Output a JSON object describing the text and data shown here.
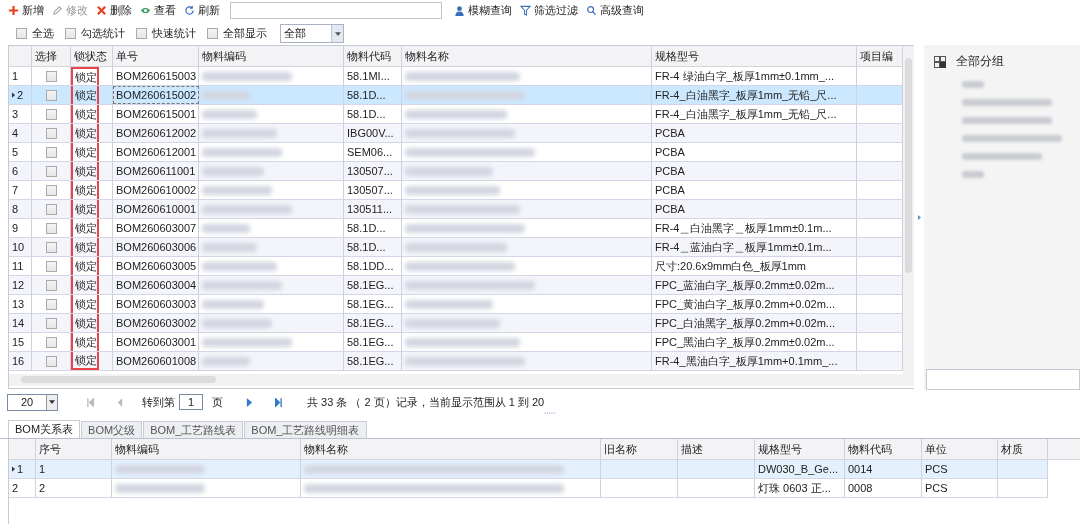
{
  "toolbar": {
    "buttons": [
      {
        "label": "新增",
        "kind": "add",
        "disabled": false
      },
      {
        "label": "修改",
        "kind": "edit",
        "disabled": true
      },
      {
        "label": "删除",
        "kind": "delete",
        "disabled": false
      },
      {
        "label": "查看",
        "kind": "view",
        "disabled": false
      },
      {
        "label": "刷新",
        "kind": "refresh",
        "disabled": false
      }
    ],
    "query_buttons": [
      {
        "label": "模糊查询",
        "kind": "person"
      },
      {
        "label": "筛选过滤",
        "kind": "filter"
      },
      {
        "label": "高级查询",
        "kind": "zoom"
      }
    ]
  },
  "filters": {
    "checkboxes": [
      {
        "label": "全选",
        "checked": false
      },
      {
        "label": "勾选统计",
        "checked": false
      },
      {
        "label": "快速统计",
        "checked": false
      },
      {
        "label": "全部显示",
        "checked": false
      }
    ],
    "dropdown": {
      "value": "全部"
    }
  },
  "grid": {
    "lock_frame": true,
    "columns": [
      {
        "label": "选择",
        "kind": "check"
      },
      {
        "label": "锁状态",
        "kind": "lock"
      },
      {
        "label": "单号",
        "kind": "text"
      },
      {
        "label": "物料编码",
        "kind": "blur"
      },
      {
        "label": "物料代码",
        "kind": "text"
      },
      {
        "label": "物料名称",
        "kind": "blur"
      },
      {
        "label": "规格型号",
        "kind": "text"
      },
      {
        "label": "项目编",
        "kind": "text"
      }
    ],
    "rows": [
      {
        "index": "1",
        "selected": false,
        "checked": false,
        "cells": [
          "",
          "锁定",
          "BOM260615003",
          "",
          "58.1MI...",
          "",
          "FR-4 绿油白字_板厚1mm±0.1mm_...",
          ""
        ]
      },
      {
        "index": "2",
        "selected": true,
        "checked": false,
        "cells": [
          "",
          "锁定",
          "BOM260615002",
          "",
          "58.1D...",
          "",
          "FR-4_白油黑字_板厚1mm_无铅_尺...",
          ""
        ]
      },
      {
        "index": "3",
        "selected": false,
        "checked": false,
        "cells": [
          "",
          "锁定",
          "BOM260615001",
          "",
          "58.1D...",
          "",
          "FR-4_白油黑字_板厚1mm_无铅_尺...",
          ""
        ]
      },
      {
        "index": "4",
        "selected": false,
        "checked": false,
        "cells": [
          "",
          "锁定",
          "BOM260612002",
          "",
          "IBG00V...",
          "",
          "PCBA",
          ""
        ]
      },
      {
        "index": "5",
        "selected": false,
        "checked": false,
        "cells": [
          "",
          "锁定",
          "BOM260612001",
          "",
          "SEM06...",
          "",
          "PCBA",
          ""
        ]
      },
      {
        "index": "6",
        "selected": false,
        "checked": false,
        "cells": [
          "",
          "锁定",
          "BOM260611001",
          "",
          "130507...",
          "",
          "PCBA",
          ""
        ]
      },
      {
        "index": "7",
        "selected": false,
        "checked": false,
        "cells": [
          "",
          "锁定",
          "BOM260610002",
          "",
          "130507...",
          "",
          "PCBA",
          ""
        ]
      },
      {
        "index": "8",
        "selected": false,
        "checked": false,
        "cells": [
          "",
          "锁定",
          "BOM260610001",
          "",
          "130511...",
          "",
          "PCBA",
          ""
        ]
      },
      {
        "index": "9",
        "selected": false,
        "checked": false,
        "cells": [
          "",
          "锁定",
          "BOM260603007",
          "",
          "58.1D...",
          "",
          "FR-4＿白油黑字＿板厚1mm±0.1m...",
          ""
        ]
      },
      {
        "index": "10",
        "selected": false,
        "checked": false,
        "cells": [
          "",
          "锁定",
          "BOM260603006",
          "",
          "58.1D...",
          "",
          "FR-4＿蓝油白字＿板厚1mm±0.1m...",
          ""
        ]
      },
      {
        "index": "11",
        "selected": false,
        "checked": false,
        "cells": [
          "",
          "锁定",
          "BOM260603005",
          "",
          "58.1DD...",
          "",
          "尺寸:20.6x9mm白色_板厚1mm",
          ""
        ]
      },
      {
        "index": "12",
        "selected": false,
        "checked": false,
        "cells": [
          "",
          "锁定",
          "BOM260603004",
          "",
          "58.1EG...",
          "",
          "FPC_蓝油白字_板厚0.2mm±0.02m...",
          ""
        ]
      },
      {
        "index": "13",
        "selected": false,
        "checked": false,
        "cells": [
          "",
          "锁定",
          "BOM260603003",
          "",
          "58.1EG...",
          "",
          "FPC_黄油白字_板厚0.2mm+0.02m...",
          ""
        ]
      },
      {
        "index": "14",
        "selected": false,
        "checked": false,
        "cells": [
          "",
          "锁定",
          "BOM260603002",
          "",
          "58.1EG...",
          "",
          "FPC_白油黑字_板厚0.2mm+0.02m...",
          ""
        ]
      },
      {
        "index": "15",
        "selected": false,
        "checked": false,
        "cells": [
          "",
          "锁定",
          "BOM260603001",
          "",
          "58.1EG...",
          "",
          "FPC_黑油白字_板厚0.2mm±0.02m...",
          ""
        ]
      },
      {
        "index": "16",
        "selected": false,
        "checked": false,
        "cells": [
          "",
          "锁定",
          "BOM260601008",
          "",
          "58.1EG...",
          "",
          "FR-4_黑油白字_板厚1mm+0.1mm_...",
          ""
        ]
      }
    ]
  },
  "side_panel": {
    "title": "全部分组"
  },
  "pager": {
    "page_size": "20",
    "nav": [
      {
        "kind": "first",
        "disabled": true
      },
      {
        "kind": "prev",
        "disabled": true
      }
    ],
    "goto_label": "转到第",
    "page": "1",
    "page_suffix": "页",
    "nav_after": [
      {
        "kind": "next",
        "disabled": false
      },
      {
        "kind": "last",
        "disabled": false
      }
    ],
    "info": "共 33 条 （ 2 页）记录，当前显示范围从 1 到 20"
  },
  "tabs": [
    {
      "label": "BOM关系表",
      "selected": true
    },
    {
      "label": "BOM父级",
      "selected": false
    },
    {
      "label": "BOM_工艺路线表",
      "selected": false
    },
    {
      "label": "BOM_工艺路线明细表",
      "selected": false
    }
  ],
  "detail_grid": {
    "columns": [
      {
        "label": "序号",
        "kind": "text"
      },
      {
        "label": "物料编码",
        "kind": "blur"
      },
      {
        "label": "物料名称",
        "kind": "blur"
      },
      {
        "label": "旧名称",
        "kind": "text"
      },
      {
        "label": "描述",
        "kind": "text"
      },
      {
        "label": "规格型号",
        "kind": "text"
      },
      {
        "label": "物料代码",
        "kind": "text"
      },
      {
        "label": "单位",
        "kind": "text"
      },
      {
        "label": "材质",
        "kind": "text"
      }
    ],
    "rows": [
      {
        "index": "1",
        "selected": true,
        "cells": [
          "1",
          "",
          "",
          "",
          "",
          "DW030_B_Ge...",
          "0014",
          "PCS",
          ""
        ]
      },
      {
        "index": "2",
        "selected": false,
        "cells": [
          "2",
          "",
          "",
          "",
          "",
          "灯珠 0603 正...",
          "0008",
          "PCS",
          ""
        ]
      }
    ]
  }
}
